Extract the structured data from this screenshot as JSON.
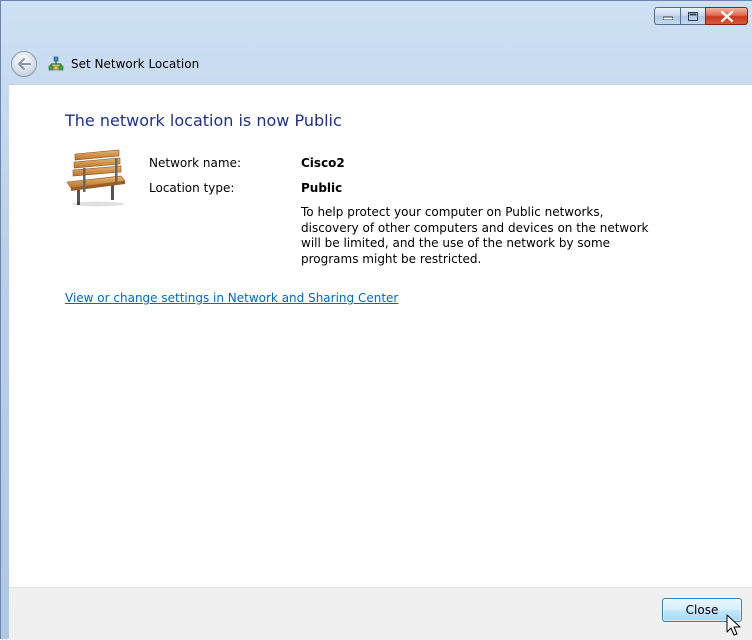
{
  "window": {
    "title": "Set Network Location",
    "caption_buttons": [
      "minimize-icon",
      "maximize-icon",
      "close-icon"
    ]
  },
  "nav": {
    "back_icon": "back-arrow-icon",
    "network_icon": "network-icon"
  },
  "content": {
    "heading": "The network location is now Public",
    "icon": "park-bench-icon",
    "network_name_label": "Network name:",
    "network_name_value": "Cisco2",
    "location_type_label": "Location type:",
    "location_type_value": "Public",
    "description": "To help protect your computer on Public networks, discovery of other computers and devices on the network will be limited, and the use of the network by some programs might be restricted.",
    "link": "View or change settings in Network and Sharing Center"
  },
  "footer": {
    "close_label": "Close"
  },
  "colors": {
    "heading": "#1e3287",
    "link": "#0066cc",
    "close_button": "#c9391c"
  }
}
